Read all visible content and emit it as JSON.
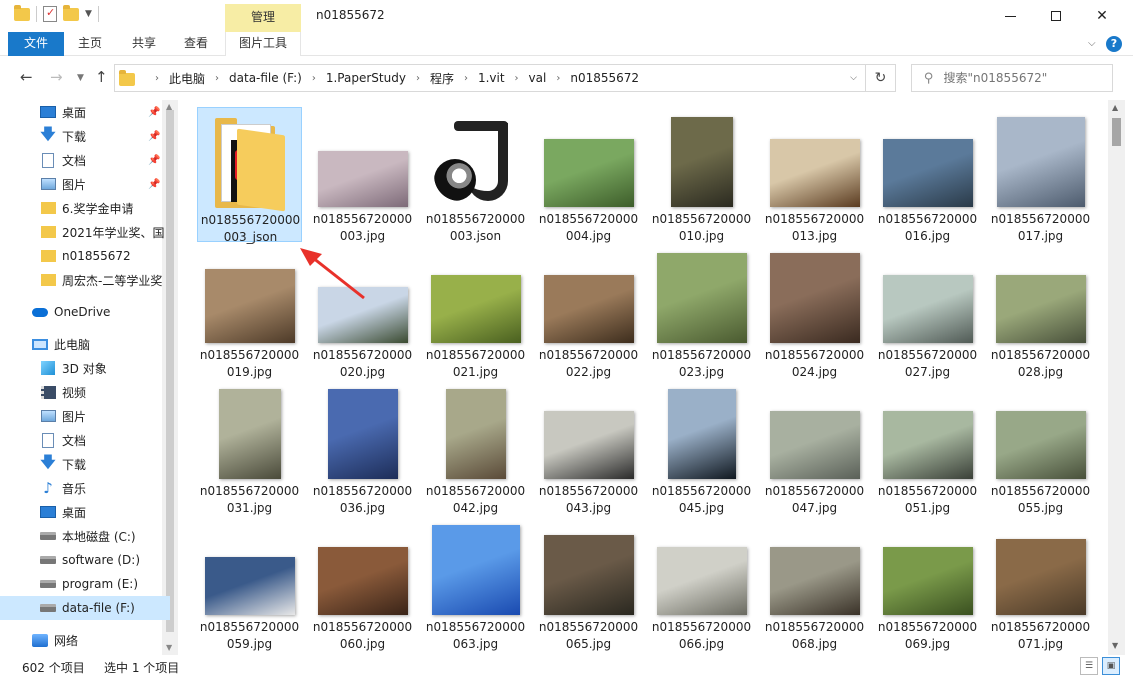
{
  "window": {
    "title": "n01855672",
    "context_tab_group": "管理"
  },
  "ribbon": {
    "tabs": [
      "文件",
      "主页",
      "共享",
      "查看",
      "图片工具"
    ],
    "help": "?"
  },
  "address": {
    "crumbs": [
      "此电脑",
      "data-file (F:)",
      "1.PaperStudy",
      "程序",
      "1.vit",
      "val",
      "n01855672"
    ],
    "search_placeholder": "搜索\"n01855672\""
  },
  "sidebar": {
    "items": [
      {
        "label": "桌面",
        "icon": "desktop-icon",
        "pinned": true
      },
      {
        "label": "下载",
        "icon": "download-icon",
        "pinned": true
      },
      {
        "label": "文档",
        "icon": "documents-icon",
        "pinned": true
      },
      {
        "label": "图片",
        "icon": "pictures-icon",
        "pinned": true
      },
      {
        "label": "6.奖学金申请",
        "icon": "folder-icon",
        "pinned": false
      },
      {
        "label": "2021年学业奖、国",
        "icon": "folder-icon",
        "pinned": false
      },
      {
        "label": "n01855672",
        "icon": "folder-icon",
        "pinned": false
      },
      {
        "label": "周宏杰-二等学业奖",
        "icon": "folder-icon",
        "pinned": false
      },
      {
        "label": "OneDrive",
        "icon": "onedrive-icon",
        "pinned": false
      },
      {
        "label": "此电脑",
        "icon": "this-pc-icon",
        "pinned": false
      },
      {
        "label": "3D 对象",
        "icon": "3d-objects-icon",
        "pinned": false
      },
      {
        "label": "视频",
        "icon": "videos-icon",
        "pinned": false
      },
      {
        "label": "图片",
        "icon": "pictures-icon",
        "pinned": false
      },
      {
        "label": "文档",
        "icon": "documents-icon",
        "pinned": false
      },
      {
        "label": "下载",
        "icon": "download-icon",
        "pinned": false
      },
      {
        "label": "音乐",
        "icon": "music-icon",
        "pinned": false
      },
      {
        "label": "桌面",
        "icon": "desktop-icon",
        "pinned": false
      },
      {
        "label": "本地磁盘 (C:)",
        "icon": "local-disk-icon",
        "pinned": false
      },
      {
        "label": "software (D:)",
        "icon": "drive-icon",
        "pinned": false
      },
      {
        "label": "program (E:)",
        "icon": "drive-icon",
        "pinned": false
      },
      {
        "label": "data-file (F:)",
        "icon": "drive-icon",
        "pinned": false,
        "selected": true
      },
      {
        "label": "网络",
        "icon": "network-icon",
        "pinned": false
      }
    ]
  },
  "files": [
    {
      "name": "n018556720000003_json",
      "kind": "folder",
      "selected": true
    },
    {
      "name": "n018556720000003.jpg",
      "kind": "image",
      "colors": [
        "#c9b8c0",
        "#7d6a78"
      ]
    },
    {
      "name": "n018556720000003.json",
      "kind": "json"
    },
    {
      "name": "n018556720000004.jpg",
      "kind": "image",
      "colors": [
        "#7aa860",
        "#3d5d2a"
      ]
    },
    {
      "name": "n018556720000010.jpg",
      "kind": "image",
      "colors": [
        "#6d6a4a",
        "#2b2a20"
      ]
    },
    {
      "name": "n018556720000013.jpg",
      "kind": "image",
      "colors": [
        "#d8c7a8",
        "#5a3b20"
      ]
    },
    {
      "name": "n018556720000016.jpg",
      "kind": "image",
      "colors": [
        "#5b7a9a",
        "#2a3a48"
      ]
    },
    {
      "name": "n018556720000017.jpg",
      "kind": "image",
      "colors": [
        "#a9b7c9",
        "#4d5b6d"
      ]
    },
    {
      "name": "n018556720000019.jpg",
      "kind": "image",
      "colors": [
        "#a88a6a",
        "#4d3a28"
      ]
    },
    {
      "name": "n018556720000020.jpg",
      "kind": "image",
      "colors": [
        "#c9d6e6",
        "#3a4a30"
      ]
    },
    {
      "name": "n018556720000021.jpg",
      "kind": "image",
      "colors": [
        "#98b04a",
        "#4a6020"
      ]
    },
    {
      "name": "n018556720000022.jpg",
      "kind": "image",
      "colors": [
        "#9a7a5a",
        "#3d2d1d"
      ]
    },
    {
      "name": "n018556720000023.jpg",
      "kind": "image",
      "colors": [
        "#8fa86a",
        "#4a5a30"
      ]
    },
    {
      "name": "n018556720000024.jpg",
      "kind": "image",
      "colors": [
        "#8a6d5a",
        "#3a2a20"
      ]
    },
    {
      "name": "n018556720000027.jpg",
      "kind": "image",
      "colors": [
        "#b8c8c0",
        "#505a55"
      ]
    },
    {
      "name": "n018556720000028.jpg",
      "kind": "image",
      "colors": [
        "#9aa87a",
        "#48503a"
      ]
    },
    {
      "name": "n018556720000031.jpg",
      "kind": "image",
      "colors": [
        "#b0b29a",
        "#4a4a3a"
      ]
    },
    {
      "name": "n018556720000036.jpg",
      "kind": "image",
      "colors": [
        "#4a6ab0",
        "#1d2d58"
      ]
    },
    {
      "name": "n018556720000042.jpg",
      "kind": "image",
      "colors": [
        "#a8a88a",
        "#5a4a38"
      ]
    },
    {
      "name": "n018556720000043.jpg",
      "kind": "image",
      "colors": [
        "#c8c8c0",
        "#2a2a2a"
      ]
    },
    {
      "name": "n018556720000045.jpg",
      "kind": "image",
      "colors": [
        "#9ab0c8",
        "#101820"
      ]
    },
    {
      "name": "n018556720000047.jpg",
      "kind": "image",
      "colors": [
        "#a8b0a0",
        "#5a6058"
      ]
    },
    {
      "name": "n018556720000051.jpg",
      "kind": "image",
      "colors": [
        "#a8b8a0",
        "#3a4038"
      ]
    },
    {
      "name": "n018556720000055.jpg",
      "kind": "image",
      "colors": [
        "#98a888",
        "#48503a"
      ]
    },
    {
      "name": "n018556720000059.jpg",
      "kind": "image",
      "colors": [
        "#3a5a8a",
        "#e8e8e8"
      ]
    },
    {
      "name": "n018556720000060.jpg",
      "kind": "image",
      "colors": [
        "#8a5a3a",
        "#3a2418"
      ]
    },
    {
      "name": "n018556720000063.jpg",
      "kind": "image",
      "colors": [
        "#5a9ae8",
        "#1a4ab0"
      ]
    },
    {
      "name": "n018556720000065.jpg",
      "kind": "image",
      "colors": [
        "#6a5a48",
        "#2a2820"
      ]
    },
    {
      "name": "n018556720000066.jpg",
      "kind": "image",
      "colors": [
        "#d0d0c8",
        "#6a6a60"
      ]
    },
    {
      "name": "n018556720000068.jpg",
      "kind": "image",
      "colors": [
        "#9a9888",
        "#3a3228"
      ]
    },
    {
      "name": "n018556720000069.jpg",
      "kind": "image",
      "colors": [
        "#7a9a4a",
        "#3a5020"
      ]
    },
    {
      "name": "n018556720000071.jpg",
      "kind": "image",
      "colors": [
        "#8a6a48",
        "#4a3a28"
      ]
    }
  ],
  "status": {
    "count": "602 个项目",
    "selection": "选中 1 个项目"
  },
  "colors": {
    "accent": "#1979ca",
    "selection": "#cce8ff",
    "arrow": "#e8312a"
  }
}
